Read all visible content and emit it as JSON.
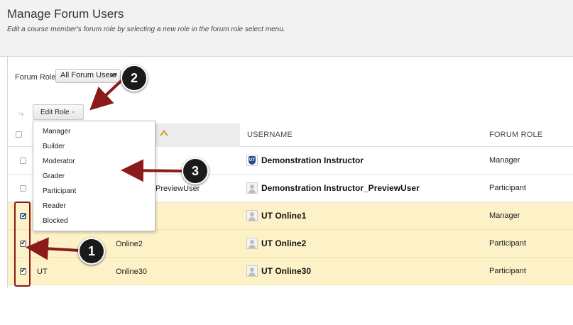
{
  "page": {
    "title": "Manage Forum Users",
    "subtitle": "Edit a course member's forum role by selecting a new role in the forum role select menu."
  },
  "filter": {
    "label": "Forum Role",
    "selected": "All Forum Users"
  },
  "toolbar": {
    "edit_role_label": "Edit Role"
  },
  "table": {
    "headers": {
      "username": "USERNAME",
      "forum_role": "FORUM ROLE"
    },
    "rows": [
      {
        "checked": false,
        "first": "",
        "last": "",
        "username": "Demonstration Instructor",
        "role": "Manager",
        "avatar": "shield-icon"
      },
      {
        "checked": false,
        "first": "",
        "last": "PreviewUser",
        "username": "Demonstration Instructor_PreviewUser",
        "role": "Participant",
        "avatar": "user-avatar-icon"
      },
      {
        "checked": true,
        "first": "",
        "last": "",
        "username": "UT Online1",
        "role": "Manager",
        "avatar": "user-avatar-icon"
      },
      {
        "checked": true,
        "first": "UT",
        "last": "Online2",
        "username": "UT Online2",
        "role": "Participant",
        "avatar": "user-avatar-icon"
      },
      {
        "checked": true,
        "first": "UT",
        "last": "Online30",
        "username": "UT Online30",
        "role": "Participant",
        "avatar": "user-avatar-icon"
      }
    ]
  },
  "role_menu": {
    "items": [
      "Manager",
      "Builder",
      "Moderator",
      "Grader",
      "Participant",
      "Reader",
      "Blocked"
    ]
  },
  "callouts": [
    "1",
    "2",
    "3"
  ],
  "colors": {
    "selected_row": "#fdf1c7",
    "annotation_red": "#8b1a1a",
    "sort_indicator": "#c79a2c"
  }
}
